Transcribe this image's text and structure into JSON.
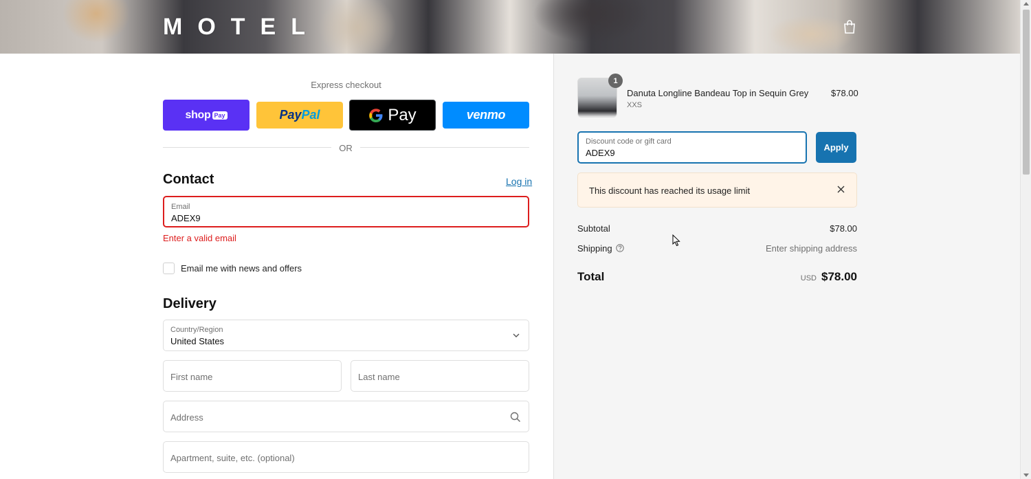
{
  "header": {
    "logo": "MOTEL",
    "cart_icon": "shopping-bag-icon"
  },
  "express": {
    "title": "Express checkout",
    "buttons": {
      "shop_pay": {
        "text": "shop",
        "tag": "Pay"
      },
      "paypal": {
        "part1": "Pay",
        "part2": "Pal"
      },
      "google_pay": {
        "g": "G",
        "text": "Pay"
      },
      "venmo": {
        "text": "venmo"
      }
    },
    "or": "OR"
  },
  "contact": {
    "title": "Contact",
    "login": "Log in",
    "email": {
      "label": "Email",
      "value": "ADEX9"
    },
    "error": "Enter a valid email",
    "newsletter": {
      "label": "Email me with news and offers",
      "checked": false
    }
  },
  "delivery": {
    "title": "Delivery",
    "country": {
      "label": "Country/Region",
      "value": "United States"
    },
    "first_name": {
      "placeholder": "First name"
    },
    "last_name": {
      "placeholder": "Last name"
    },
    "address": {
      "placeholder": "Address"
    },
    "apartment": {
      "placeholder": "Apartment, suite, etc. (optional)"
    }
  },
  "summary": {
    "product": {
      "quantity": "1",
      "name": "Danuta Longline Bandeau Top in Sequin Grey",
      "variant": "XXS",
      "price": "$78.00"
    },
    "discount": {
      "label": "Discount code or gift card",
      "value": "ADEX9",
      "apply": "Apply"
    },
    "notice": "This discount has reached its usage limit",
    "subtotal": {
      "label": "Subtotal",
      "value": "$78.00"
    },
    "shipping": {
      "label": "Shipping",
      "value": "Enter shipping address"
    },
    "total": {
      "label": "Total",
      "currency": "USD",
      "value": "$78.00"
    }
  },
  "colors": {
    "accent": "#1773b0",
    "error": "#dd1d1d",
    "shop_pay": "#5a31f4",
    "paypal": "#ffc439",
    "venmo": "#008cff",
    "notice_bg": "#fff4e8"
  }
}
